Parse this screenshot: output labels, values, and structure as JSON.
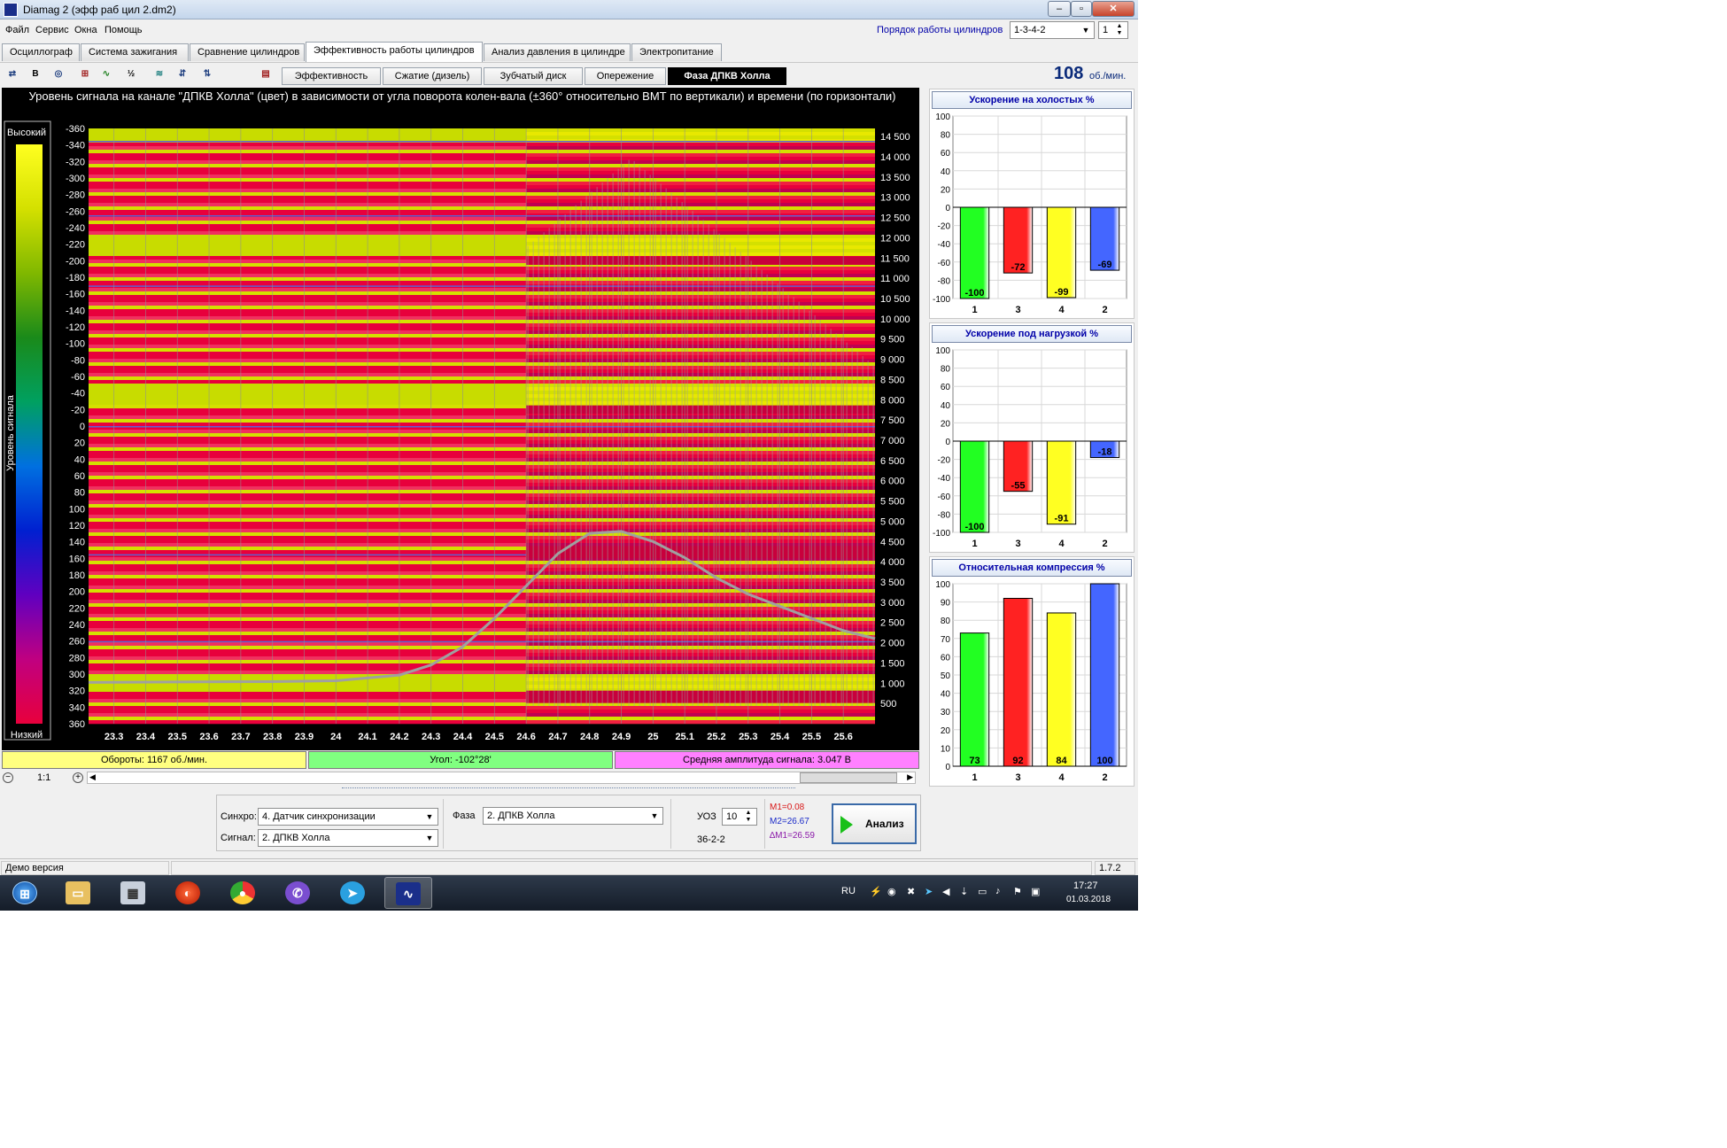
{
  "window": {
    "title": "Diamag 2 (эфф раб цил 2.dm2)"
  },
  "menu": [
    "Файл",
    "Сервис",
    "Окна",
    "Помощь"
  ],
  "cylinder_order": {
    "label": "Порядок работы цилиндров",
    "value": "1-3-4-2",
    "cycle": "1"
  },
  "tabs": [
    "Осциллограф",
    "Система зажигания",
    "Сравнение цилиндров",
    "Эффективность работы цилиндров",
    "Анализ давления в цилиндре",
    "Электропитание"
  ],
  "active_tab": "Эффективность работы цилиндров",
  "toolbar": {
    "icons": [
      "sync-icon",
      "bold-b-icon",
      "rpm-icon",
      "align-left-icon",
      "waveform-icon",
      "scale-icon",
      "filter-icon",
      "zoom-icon",
      "adjust-icon",
      "document-icon"
    ],
    "subtabs": [
      "Эффективность",
      "Сжатие (дизель)",
      "Зубчатый диск",
      "Опережение",
      "Фаза ДПКВ Холла"
    ],
    "active_subtab": "Фаза ДПКВ Холла",
    "rpm_value": "108",
    "rpm_unit": "об./мин."
  },
  "chart": {
    "title": "Уровень сигнала на канале \"ДПКВ Холла\" (цвет) в зависимости от угла поворота колен-вала (±360° относительно ВМТ по вертикали) и времени (по горизонтали)",
    "legend_high": "Высокий",
    "legend_low": "Низкий",
    "legend_axis": "Уровень сигнала"
  },
  "chart_data": {
    "type": "heatmap",
    "title": "Уровень сигнала на канале \"ДПКВ Холла\" (цвет) в зависимости от угла поворота колен-вала (±360° относительно ВМТ по вертикали) и времени (по горизонтали)",
    "x_ticks": [
      "23.3",
      "23.4",
      "23.5",
      "23.6",
      "23.7",
      "23.8",
      "23.9",
      "24",
      "24.1",
      "24.2",
      "24.3",
      "24.4",
      "24.5",
      "24.6",
      "24.7",
      "24.8",
      "24.9",
      "25",
      "25.1",
      "25.2",
      "25.3",
      "25.4",
      "25.5",
      "25.6"
    ],
    "xlim": [
      23.22,
      25.7
    ],
    "y_ticks": [
      -360,
      -340,
      -320,
      -300,
      -280,
      -260,
      -240,
      -220,
      -200,
      -180,
      -160,
      -140,
      -120,
      -100,
      -80,
      -60,
      -40,
      -20,
      0,
      20,
      40,
      60,
      80,
      100,
      120,
      140,
      160,
      180,
      200,
      220,
      240,
      260,
      280,
      300,
      320,
      340,
      360
    ],
    "ylim": [
      -360,
      360
    ],
    "y2_ticks": [
      "14 500",
      "14 000",
      "13 500",
      "13 000",
      "12 500",
      "12 000",
      "11 500",
      "11 000",
      "10 500",
      "10 000",
      "9 500",
      "9 000",
      "8 500",
      "8 000",
      "7 500",
      "7 000",
      "6 500",
      "6 000",
      "5 500",
      "5 000",
      "4 500",
      "4 000",
      "3 500",
      "3 000",
      "2 500",
      "2 000",
      "1 500",
      "1 000",
      "500"
    ],
    "y2lim": [
      0,
      14700
    ],
    "rpm_trace": {
      "x": [
        23.22,
        23.5,
        23.8,
        24.0,
        24.2,
        24.3,
        24.4,
        24.5,
        24.6,
        24.7,
        24.8,
        24.9,
        25.0,
        25.1,
        25.2,
        25.3,
        25.4,
        25.5,
        25.6,
        25.7
      ],
      "y": [
        1020,
        1030,
        1040,
        1060,
        1200,
        1450,
        1900,
        2600,
        3400,
        4200,
        4700,
        4750,
        4500,
        4100,
        3600,
        3200,
        2900,
        2600,
        2300,
        2100
      ]
    },
    "color_map": [
      "#e8003c",
      "#c00080",
      "#6000c0",
      "#0020d0",
      "#0070e0",
      "#00a060",
      "#1a8a1a",
      "#80b800",
      "#d4e000",
      "#ffff20"
    ]
  },
  "info_bars": {
    "rpm": "Обороты:  1167 об./мин.",
    "angle": "Угол:  -102°28'",
    "amplitude": "Средняя амплитуда сигнала:  3.047 В",
    "colors": [
      "#ffff80",
      "#80ff80",
      "#ff80ff"
    ]
  },
  "zoom": {
    "label": "1:1"
  },
  "bar_charts": [
    {
      "title": "Ускорение на холостых %",
      "type": "bar",
      "categories": [
        "1",
        "3",
        "4",
        "2"
      ],
      "values": [
        -100,
        -72,
        -99,
        -69
      ],
      "ylim": [
        -100,
        100
      ],
      "y_ticks": [
        100,
        80,
        60,
        40,
        20,
        0,
        -20,
        -40,
        -60,
        -80,
        -100
      ]
    },
    {
      "title": "Ускорение под нагрузкой %",
      "type": "bar",
      "categories": [
        "1",
        "3",
        "4",
        "2"
      ],
      "values": [
        -100,
        -55,
        -91,
        -18
      ],
      "ylim": [
        -100,
        100
      ],
      "y_ticks": [
        100,
        80,
        60,
        40,
        20,
        0,
        -20,
        -40,
        -60,
        -80,
        -100
      ]
    },
    {
      "title": "Относительная компрессия %",
      "type": "bar",
      "categories": [
        "1",
        "3",
        "4",
        "2"
      ],
      "values": [
        73,
        92,
        84,
        100
      ],
      "ylim": [
        0,
        100
      ],
      "y_ticks": [
        100,
        90,
        80,
        70,
        60,
        50,
        40,
        30,
        20,
        10,
        0
      ]
    }
  ],
  "bar_colors": [
    "#22ff22",
    "#ff2222",
    "#ffff22",
    "#4466ff"
  ],
  "controls": {
    "sync_label": "Синхро:",
    "sync_value": "4.  Датчик синхронизации",
    "signal_label": "Сигнал:",
    "signal_value": "2.  ДПКВ Холла",
    "phase_label": "Фаза",
    "phase_value": "2.  ДПКВ Холла",
    "uoz_label": "УОЗ",
    "uoz_value": "10",
    "pattern": "36-2-2",
    "m1": "M1=0.08",
    "m2": "M2=26.67",
    "dm1": "∆M1=26.59",
    "analyze_label": "Анализ"
  },
  "status": {
    "left": "Демо версия",
    "version": "1.7.2"
  },
  "taskbar": {
    "apps": [
      "start-orb",
      "explorer-icon",
      "calculator-icon",
      "game-icon",
      "chrome-icon",
      "viber-icon",
      "telegram-icon",
      "diamag-icon"
    ],
    "lang": "RU",
    "time": "17:27",
    "date": "01.03.2018"
  }
}
